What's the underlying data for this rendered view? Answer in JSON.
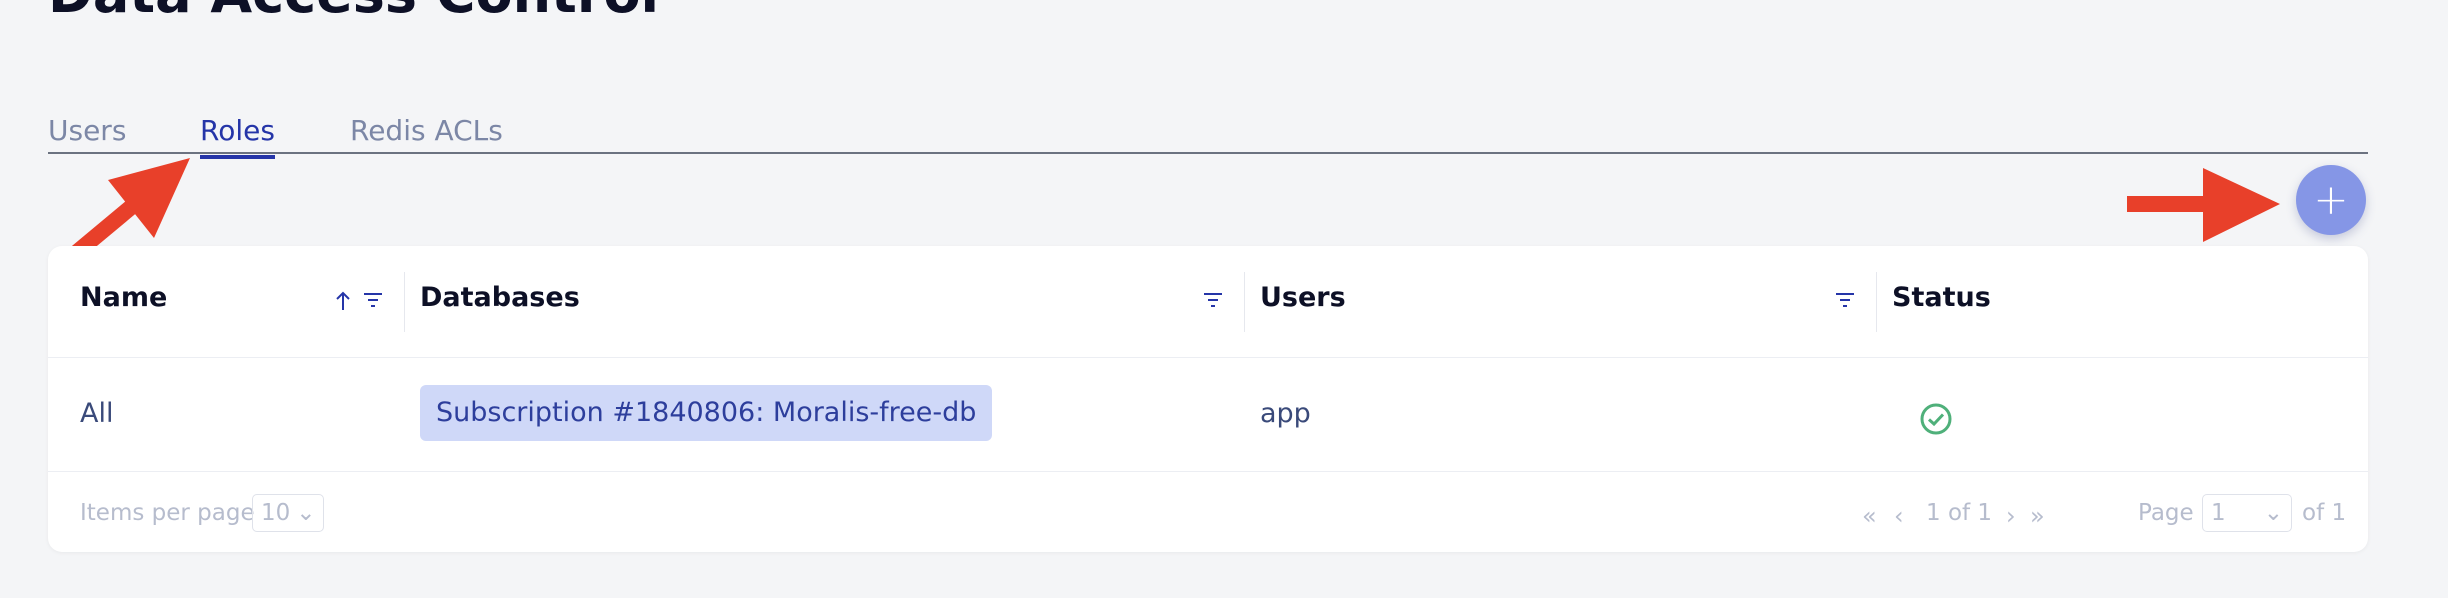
{
  "page": {
    "title": "Data Access Control"
  },
  "tabs": [
    {
      "label": "Users",
      "active": false
    },
    {
      "label": "Roles",
      "active": true
    },
    {
      "label": "Redis ACLs",
      "active": false
    }
  ],
  "add_button": {
    "icon": "plus-icon",
    "label": "+"
  },
  "table": {
    "columns": [
      "Name",
      "Databases",
      "Users",
      "Status"
    ],
    "rows": [
      {
        "name": "All",
        "databases": [
          "Subscription #1840806: Moralis-free-db"
        ],
        "users": "app",
        "status": "check-circle-icon"
      }
    ]
  },
  "pagination": {
    "items_per_page_label": "Items per page",
    "items_per_page_value": "10",
    "range": "1 of 1",
    "page_label": "Page",
    "page_value": "1",
    "page_total": "of 1"
  },
  "colors": {
    "accent": "#2535a8",
    "add_button": "#8596e6",
    "chip_bg": "#cfd8f8",
    "status_ok": "#4fb07a",
    "annotation_arrow": "#e8402a"
  }
}
